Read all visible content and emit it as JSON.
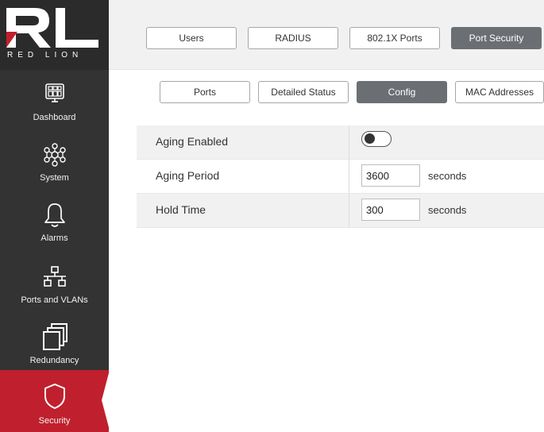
{
  "brand": {
    "logo_letters": "RL",
    "logo_text": "RED LION",
    "accent": "#c0202d"
  },
  "sidebar": {
    "items": [
      {
        "label": "Dashboard",
        "icon": "dashboard-icon",
        "active": false
      },
      {
        "label": "System",
        "icon": "system-icon",
        "active": false
      },
      {
        "label": "Alarms",
        "icon": "bell-icon",
        "active": false
      },
      {
        "label": "Ports and VLANs",
        "icon": "network-icon",
        "active": false
      },
      {
        "label": "Redundancy",
        "icon": "redundancy-icon",
        "active": false
      },
      {
        "label": "Security",
        "icon": "shield-icon",
        "active": true
      }
    ]
  },
  "top_tabs": [
    {
      "label": "Users",
      "active": false
    },
    {
      "label": "RADIUS",
      "active": false
    },
    {
      "label": "802.1X Ports",
      "active": false
    },
    {
      "label": "Port Security",
      "active": true
    }
  ],
  "sub_tabs": [
    {
      "label": "Ports",
      "active": false
    },
    {
      "label": "Detailed Status",
      "active": false
    },
    {
      "label": "Config",
      "active": true
    },
    {
      "label": "MAC Addresses",
      "active": false
    }
  ],
  "config": {
    "aging_enabled": {
      "label": "Aging Enabled",
      "value": false
    },
    "aging_period": {
      "label": "Aging Period",
      "value": "3600",
      "unit": "seconds"
    },
    "hold_time": {
      "label": "Hold Time",
      "value": "300",
      "unit": "seconds"
    }
  }
}
